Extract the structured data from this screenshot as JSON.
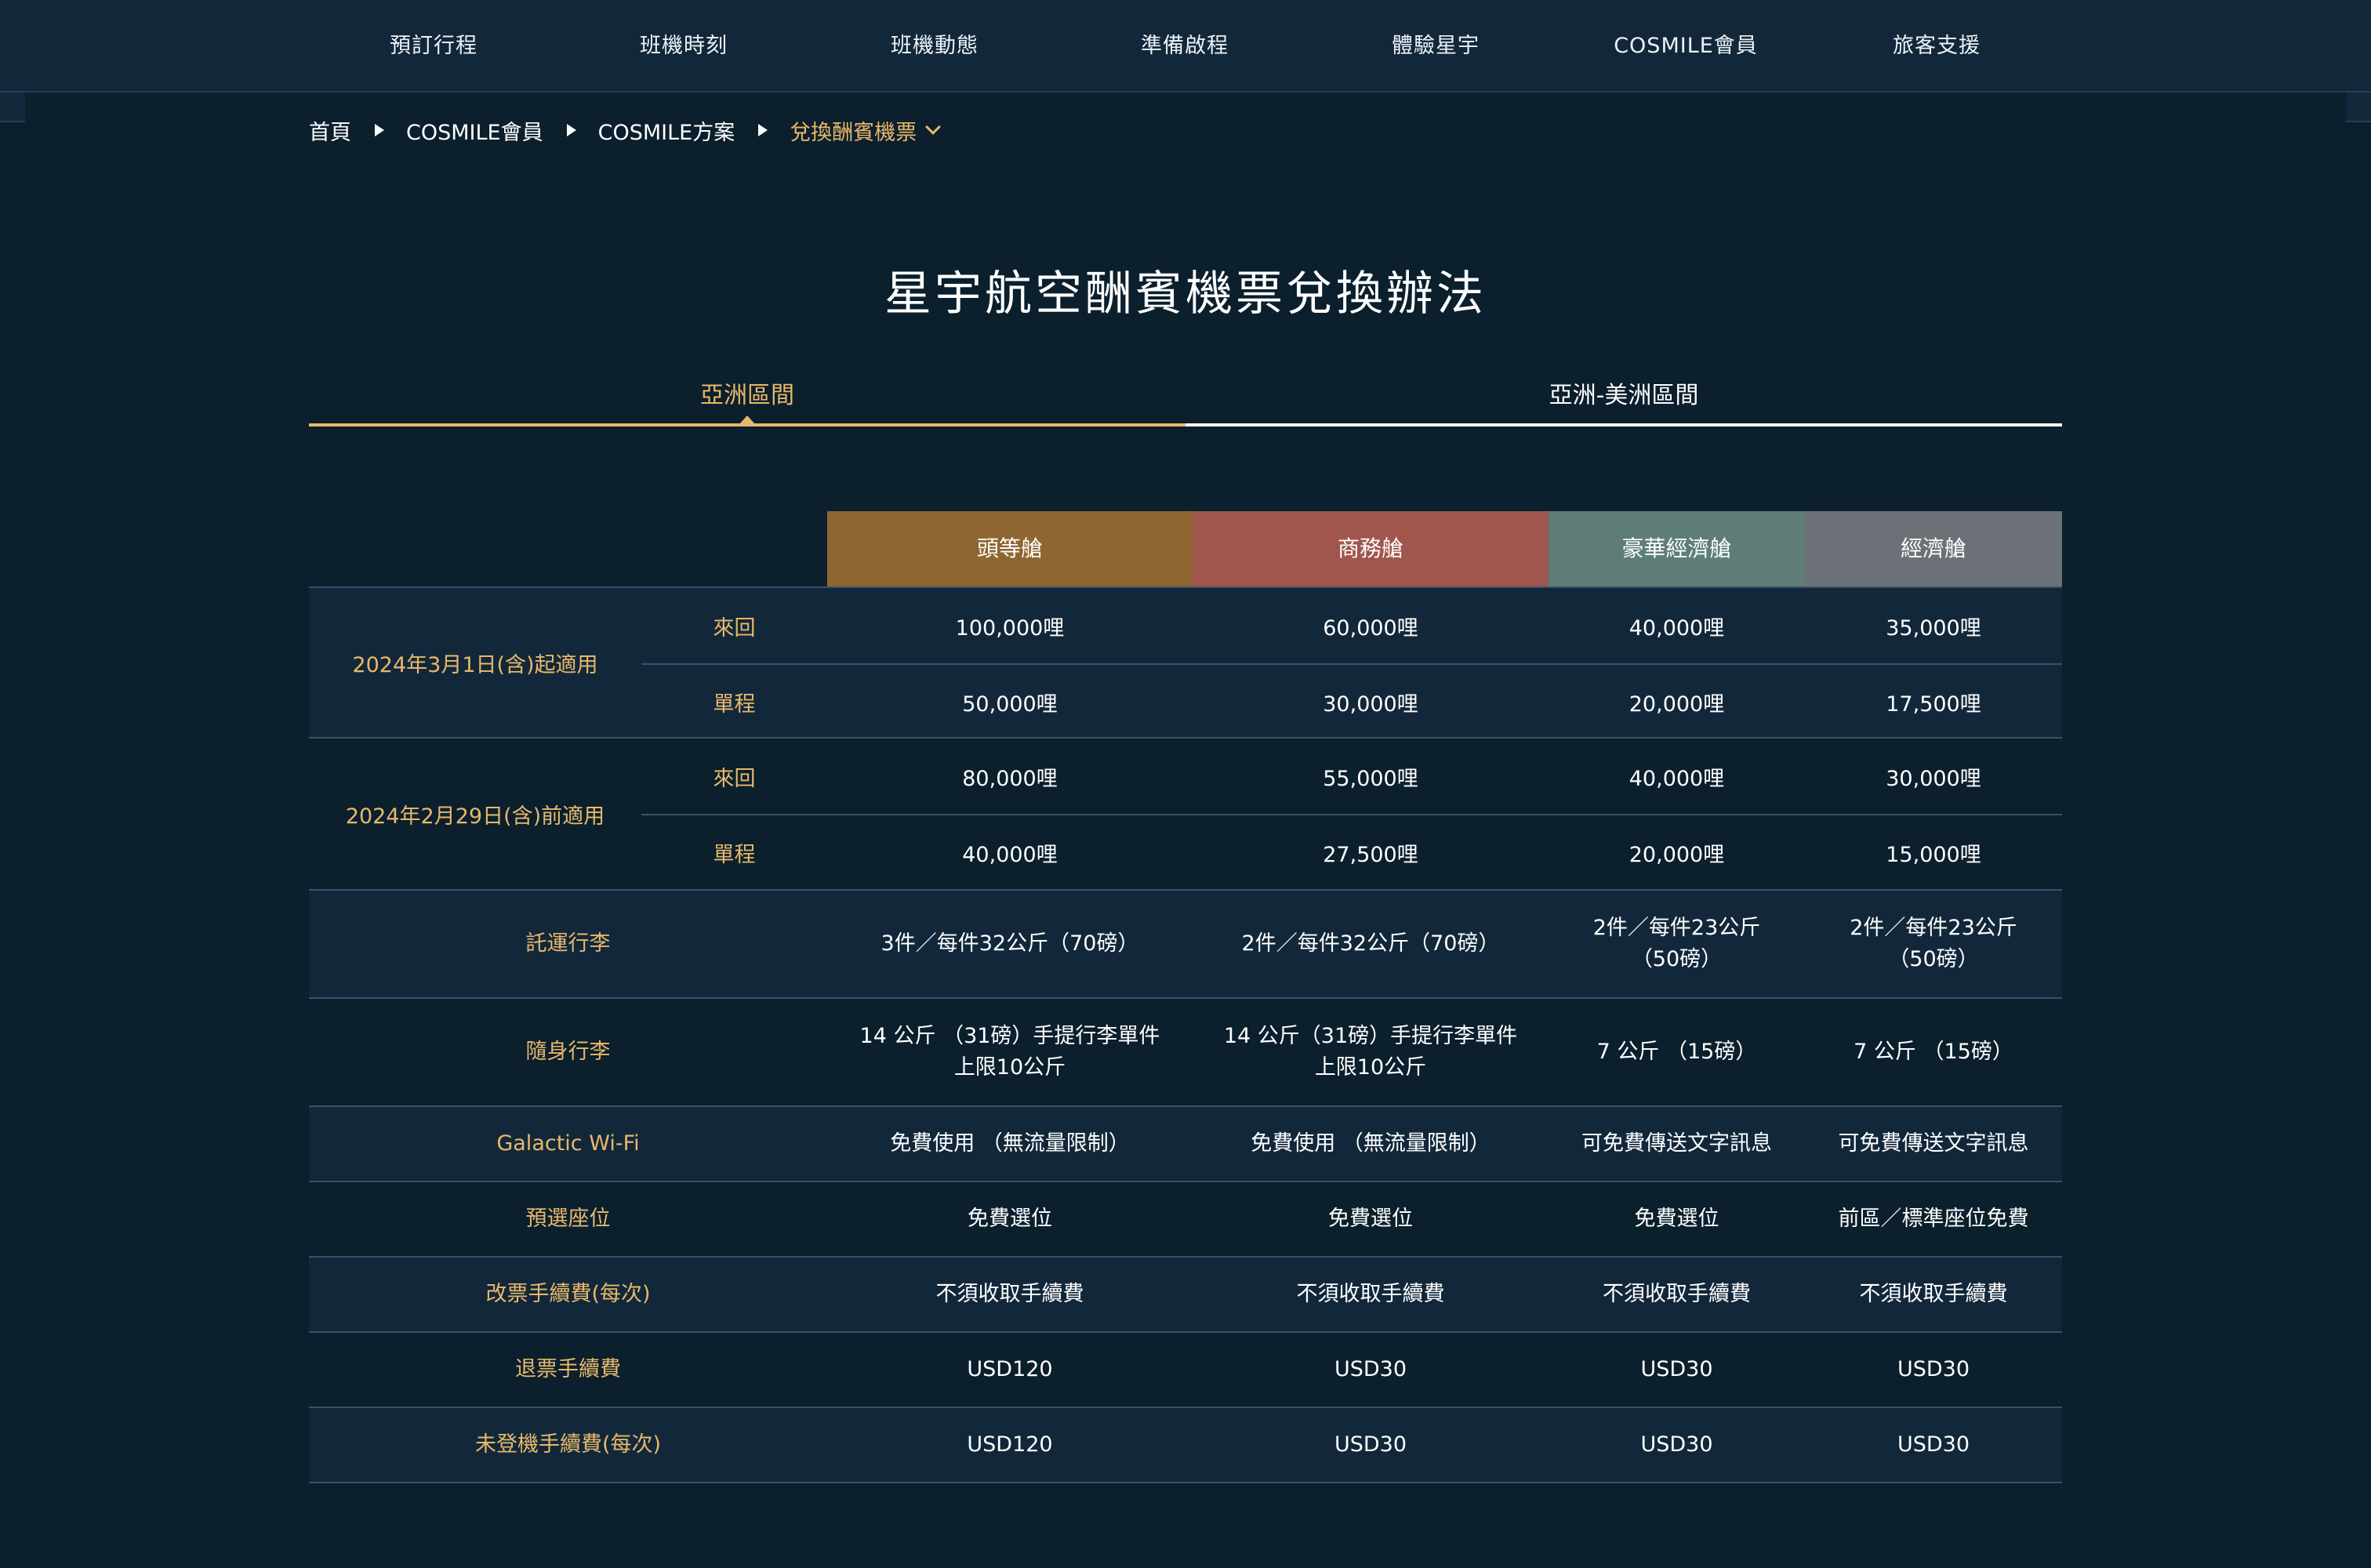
{
  "nav": {
    "items": [
      "預訂行程",
      "班機時刻",
      "班機動態",
      "準備啟程",
      "體驗星宇",
      "COSMILE會員",
      "旅客支援"
    ]
  },
  "breadcrumb": {
    "home": "首頁",
    "level1": "COSMILE會員",
    "level2": "COSMILE方案",
    "current": "兌換酬賓機票"
  },
  "title": "星宇航空酬賓機票兌換辦法",
  "tabs": {
    "asia": "亞洲區間",
    "americas": "亞洲-美洲區間",
    "active": "亞洲區間"
  },
  "table": {
    "headers": {
      "first": "頭等艙",
      "business": "商務艙",
      "premium": "豪華經濟艙",
      "economy": "經濟艙"
    },
    "header_colors": {
      "first": "#8e6630",
      "business": "#a0554d",
      "premium": "#5e7d78",
      "economy": "#6c7177"
    },
    "periods": [
      {
        "label": "2024年3月1日(含)起適用",
        "roundtrip_label": "來回",
        "oneway_label": "單程",
        "roundtrip": [
          "100,000哩",
          "60,000哩",
          "40,000哩",
          "35,000哩"
        ],
        "oneway": [
          "50,000哩",
          "30,000哩",
          "20,000哩",
          "17,500哩"
        ]
      },
      {
        "label": "2024年2月29日(含)前適用",
        "roundtrip_label": "來回",
        "oneway_label": "單程",
        "roundtrip": [
          "80,000哩",
          "55,000哩",
          "40,000哩",
          "30,000哩"
        ],
        "oneway": [
          "40,000哩",
          "27,500哩",
          "20,000哩",
          "15,000哩"
        ]
      }
    ],
    "rows": [
      {
        "label": "託運行李",
        "values": [
          "3件／每件32公斤（70磅）",
          "2件／每件32公斤（70磅）",
          "2件／每件23公斤\n（50磅）",
          "2件／每件23公斤\n（50磅）"
        ]
      },
      {
        "label": "隨身行李",
        "values": [
          "14 公斤 （31磅）手提行李單件\n上限10公斤",
          "14 公斤（31磅）手提行李單件\n上限10公斤",
          "7 公斤 （15磅）",
          "7 公斤 （15磅）"
        ]
      },
      {
        "label": "Galactic Wi-Fi",
        "values": [
          "免費使用 （無流量限制）",
          "免費使用 （無流量限制）",
          "可免費傳送文字訊息",
          "可免費傳送文字訊息"
        ]
      },
      {
        "label": "預選座位",
        "values": [
          "免費選位",
          "免費選位",
          "免費選位",
          "前區／標準座位免費"
        ]
      },
      {
        "label": "改票手續費(每次)",
        "values": [
          "不須收取手續費",
          "不須收取手續費",
          "不須收取手續費",
          "不須收取手續費"
        ]
      },
      {
        "label": "退票手續費",
        "values": [
          "USD120",
          "USD30",
          "USD30",
          "USD30"
        ]
      },
      {
        "label": "未登機手續費(每次)",
        "values": [
          "USD120",
          "USD30",
          "USD30",
          "USD30"
        ]
      }
    ]
  },
  "colors": {
    "background": "#0b1f2d",
    "row_alt": "#12283a",
    "accent_gold": "#e8b86a"
  }
}
